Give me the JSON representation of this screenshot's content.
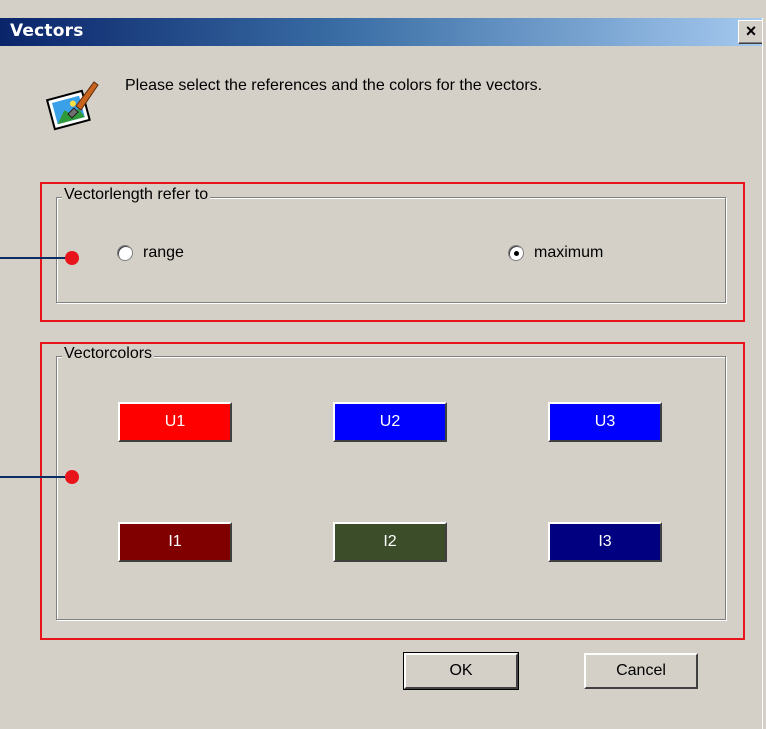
{
  "window": {
    "title": "Vectors",
    "close_glyph": "✕"
  },
  "header": {
    "icon": "paint-brush-icon",
    "message": "Please select the references and the colors for the vectors."
  },
  "vector_length": {
    "title": "Vectorlength refer to",
    "options": [
      {
        "label": "range",
        "selected": false
      },
      {
        "label": "maximum",
        "selected": true
      }
    ]
  },
  "vector_colors": {
    "title": "Vectorcolors",
    "buttons": [
      {
        "label": "U1",
        "color": "#ff0000"
      },
      {
        "label": "U2",
        "color": "#0000ff"
      },
      {
        "label": "U3",
        "color": "#0000ff"
      },
      {
        "label": "I1",
        "color": "#800000"
      },
      {
        "label": "I2",
        "color": "#3c4d2a"
      },
      {
        "label": "I3",
        "color": "#000080"
      }
    ]
  },
  "actions": {
    "ok_label": "OK",
    "cancel_label": "Cancel"
  },
  "annotations": {
    "highlight_color": "#e8141c",
    "line_color": "#0b2d63"
  }
}
